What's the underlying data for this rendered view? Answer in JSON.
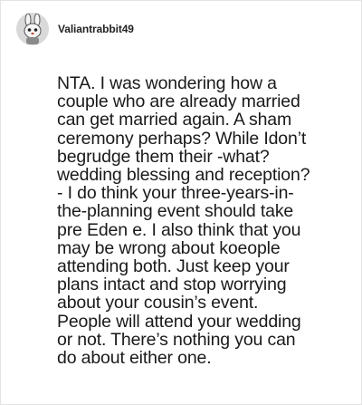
{
  "comment": {
    "author": {
      "username": "Valiantrabbit49",
      "avatar_icon": "bunny-avatar-icon"
    },
    "body_lines": [
      "NTA. I was wondering how a",
      "couple who are already married",
      "can get married again. A sham",
      "ceremony perhaps? While Idon’t",
      "begrudge them their -what?",
      "wedding blessing and reception?",
      "- I do think your three-years-in-",
      "the-planning event should take",
      "pre Eden e. I also think that you",
      "may be wrong about koeople",
      "attending both. Just keep your",
      "plans intact and stop worrying",
      "about your cousin’s event.",
      "People will attend your wedding",
      "or not. There’s nothing you can",
      "do about either one."
    ]
  }
}
